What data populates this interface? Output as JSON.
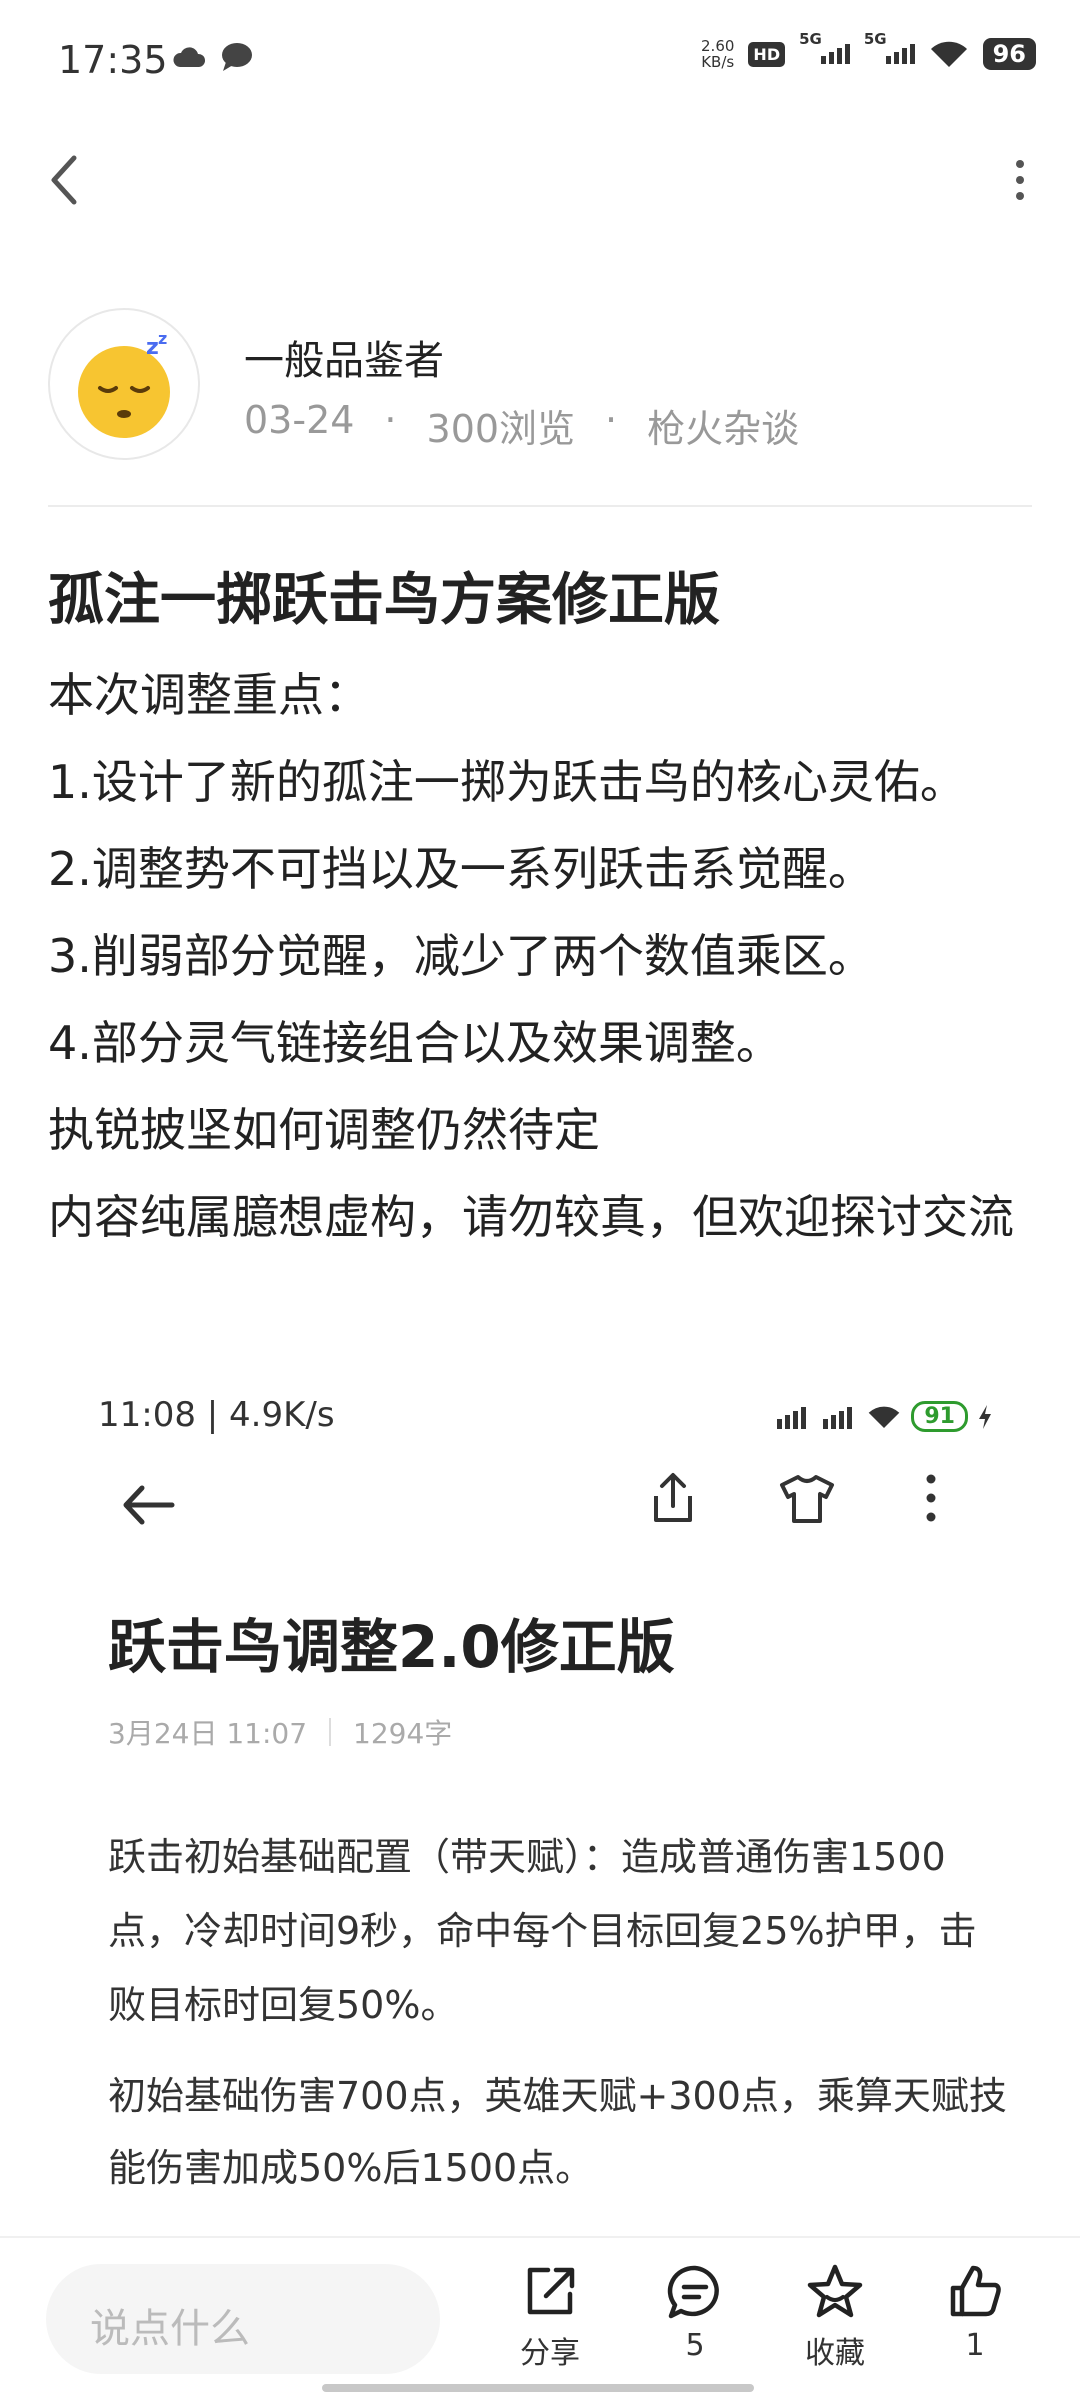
{
  "status_bar": {
    "time": "17:35",
    "net_speed_value": "2.60",
    "net_speed_unit": "KB/s",
    "hd_label": "HD",
    "sim1": "5G",
    "sim2": "5G",
    "battery": "96"
  },
  "author": {
    "name": "一般品鉴者",
    "date": "03-24",
    "views": "300浏览",
    "category": "枪火杂谈"
  },
  "post": {
    "title": "孤注一掷跃击鸟方案修正版",
    "lines": [
      "本次调整重点：",
      "1.设计了新的孤注一掷为跃击鸟的核心灵佑。",
      "2.调整势不可挡以及一系列跃击系觉醒。",
      "3.削弱部分觉醒，减少了两个数值乘区。",
      "4.部分灵气链接组合以及效果调整。",
      "执锐披坚如何调整仍然待定",
      "内容纯属臆想虚构，请勿较真，但欢迎探讨交流"
    ]
  },
  "embedded_screenshot": {
    "status_time": "11:08 | 4.9K/s",
    "battery": "91",
    "title": "跃击鸟调整2.0修正版",
    "date": "3月24日 11:07",
    "word_count": "1294字",
    "paragraph1": "跃击初始基础配置（带天赋）：造成普通伤害1500点，冷却时间9秒，命中每个目标回复25%护甲，击败目标时回复50%。",
    "paragraph2": "初始基础伤害700点，英雄天赋+300点，乘算天赋技能伤害加成50%后1500点。"
  },
  "bottom_bar": {
    "comment_placeholder": "说点什么",
    "share_label": "分享",
    "comment_count": "5",
    "favorite_label": "收藏",
    "like_count": "1"
  },
  "colors": {
    "text_primary": "#222222",
    "text_secondary": "#999999",
    "battery_green": "#2e9b2e"
  }
}
